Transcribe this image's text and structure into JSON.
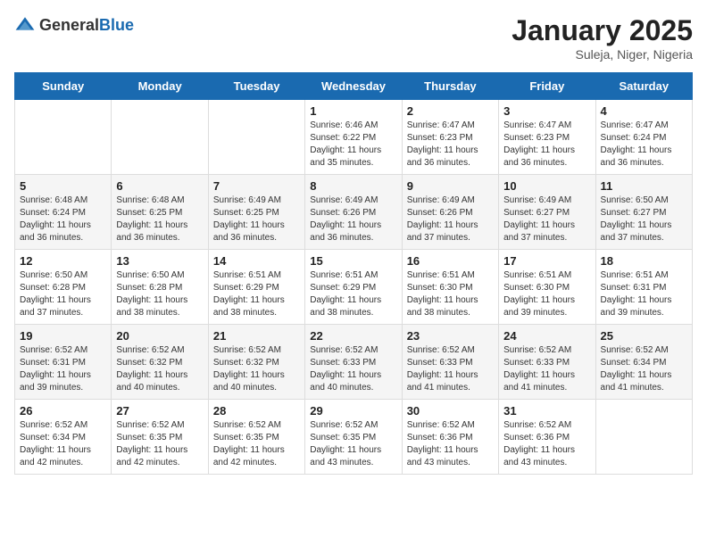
{
  "header": {
    "logo_general": "General",
    "logo_blue": "Blue",
    "month_title": "January 2025",
    "location": "Suleja, Niger, Nigeria"
  },
  "weekdays": [
    "Sunday",
    "Monday",
    "Tuesday",
    "Wednesday",
    "Thursday",
    "Friday",
    "Saturday"
  ],
  "weeks": [
    [
      {
        "day": "",
        "info": ""
      },
      {
        "day": "",
        "info": ""
      },
      {
        "day": "",
        "info": ""
      },
      {
        "day": "1",
        "info": "Sunrise: 6:46 AM\nSunset: 6:22 PM\nDaylight: 11 hours and 35 minutes."
      },
      {
        "day": "2",
        "info": "Sunrise: 6:47 AM\nSunset: 6:23 PM\nDaylight: 11 hours and 36 minutes."
      },
      {
        "day": "3",
        "info": "Sunrise: 6:47 AM\nSunset: 6:23 PM\nDaylight: 11 hours and 36 minutes."
      },
      {
        "day": "4",
        "info": "Sunrise: 6:47 AM\nSunset: 6:24 PM\nDaylight: 11 hours and 36 minutes."
      }
    ],
    [
      {
        "day": "5",
        "info": "Sunrise: 6:48 AM\nSunset: 6:24 PM\nDaylight: 11 hours and 36 minutes."
      },
      {
        "day": "6",
        "info": "Sunrise: 6:48 AM\nSunset: 6:25 PM\nDaylight: 11 hours and 36 minutes."
      },
      {
        "day": "7",
        "info": "Sunrise: 6:49 AM\nSunset: 6:25 PM\nDaylight: 11 hours and 36 minutes."
      },
      {
        "day": "8",
        "info": "Sunrise: 6:49 AM\nSunset: 6:26 PM\nDaylight: 11 hours and 36 minutes."
      },
      {
        "day": "9",
        "info": "Sunrise: 6:49 AM\nSunset: 6:26 PM\nDaylight: 11 hours and 37 minutes."
      },
      {
        "day": "10",
        "info": "Sunrise: 6:49 AM\nSunset: 6:27 PM\nDaylight: 11 hours and 37 minutes."
      },
      {
        "day": "11",
        "info": "Sunrise: 6:50 AM\nSunset: 6:27 PM\nDaylight: 11 hours and 37 minutes."
      }
    ],
    [
      {
        "day": "12",
        "info": "Sunrise: 6:50 AM\nSunset: 6:28 PM\nDaylight: 11 hours and 37 minutes."
      },
      {
        "day": "13",
        "info": "Sunrise: 6:50 AM\nSunset: 6:28 PM\nDaylight: 11 hours and 38 minutes."
      },
      {
        "day": "14",
        "info": "Sunrise: 6:51 AM\nSunset: 6:29 PM\nDaylight: 11 hours and 38 minutes."
      },
      {
        "day": "15",
        "info": "Sunrise: 6:51 AM\nSunset: 6:29 PM\nDaylight: 11 hours and 38 minutes."
      },
      {
        "day": "16",
        "info": "Sunrise: 6:51 AM\nSunset: 6:30 PM\nDaylight: 11 hours and 38 minutes."
      },
      {
        "day": "17",
        "info": "Sunrise: 6:51 AM\nSunset: 6:30 PM\nDaylight: 11 hours and 39 minutes."
      },
      {
        "day": "18",
        "info": "Sunrise: 6:51 AM\nSunset: 6:31 PM\nDaylight: 11 hours and 39 minutes."
      }
    ],
    [
      {
        "day": "19",
        "info": "Sunrise: 6:52 AM\nSunset: 6:31 PM\nDaylight: 11 hours and 39 minutes."
      },
      {
        "day": "20",
        "info": "Sunrise: 6:52 AM\nSunset: 6:32 PM\nDaylight: 11 hours and 40 minutes."
      },
      {
        "day": "21",
        "info": "Sunrise: 6:52 AM\nSunset: 6:32 PM\nDaylight: 11 hours and 40 minutes."
      },
      {
        "day": "22",
        "info": "Sunrise: 6:52 AM\nSunset: 6:33 PM\nDaylight: 11 hours and 40 minutes."
      },
      {
        "day": "23",
        "info": "Sunrise: 6:52 AM\nSunset: 6:33 PM\nDaylight: 11 hours and 41 minutes."
      },
      {
        "day": "24",
        "info": "Sunrise: 6:52 AM\nSunset: 6:33 PM\nDaylight: 11 hours and 41 minutes."
      },
      {
        "day": "25",
        "info": "Sunrise: 6:52 AM\nSunset: 6:34 PM\nDaylight: 11 hours and 41 minutes."
      }
    ],
    [
      {
        "day": "26",
        "info": "Sunrise: 6:52 AM\nSunset: 6:34 PM\nDaylight: 11 hours and 42 minutes."
      },
      {
        "day": "27",
        "info": "Sunrise: 6:52 AM\nSunset: 6:35 PM\nDaylight: 11 hours and 42 minutes."
      },
      {
        "day": "28",
        "info": "Sunrise: 6:52 AM\nSunset: 6:35 PM\nDaylight: 11 hours and 42 minutes."
      },
      {
        "day": "29",
        "info": "Sunrise: 6:52 AM\nSunset: 6:35 PM\nDaylight: 11 hours and 43 minutes."
      },
      {
        "day": "30",
        "info": "Sunrise: 6:52 AM\nSunset: 6:36 PM\nDaylight: 11 hours and 43 minutes."
      },
      {
        "day": "31",
        "info": "Sunrise: 6:52 AM\nSunset: 6:36 PM\nDaylight: 11 hours and 43 minutes."
      },
      {
        "day": "",
        "info": ""
      }
    ]
  ]
}
